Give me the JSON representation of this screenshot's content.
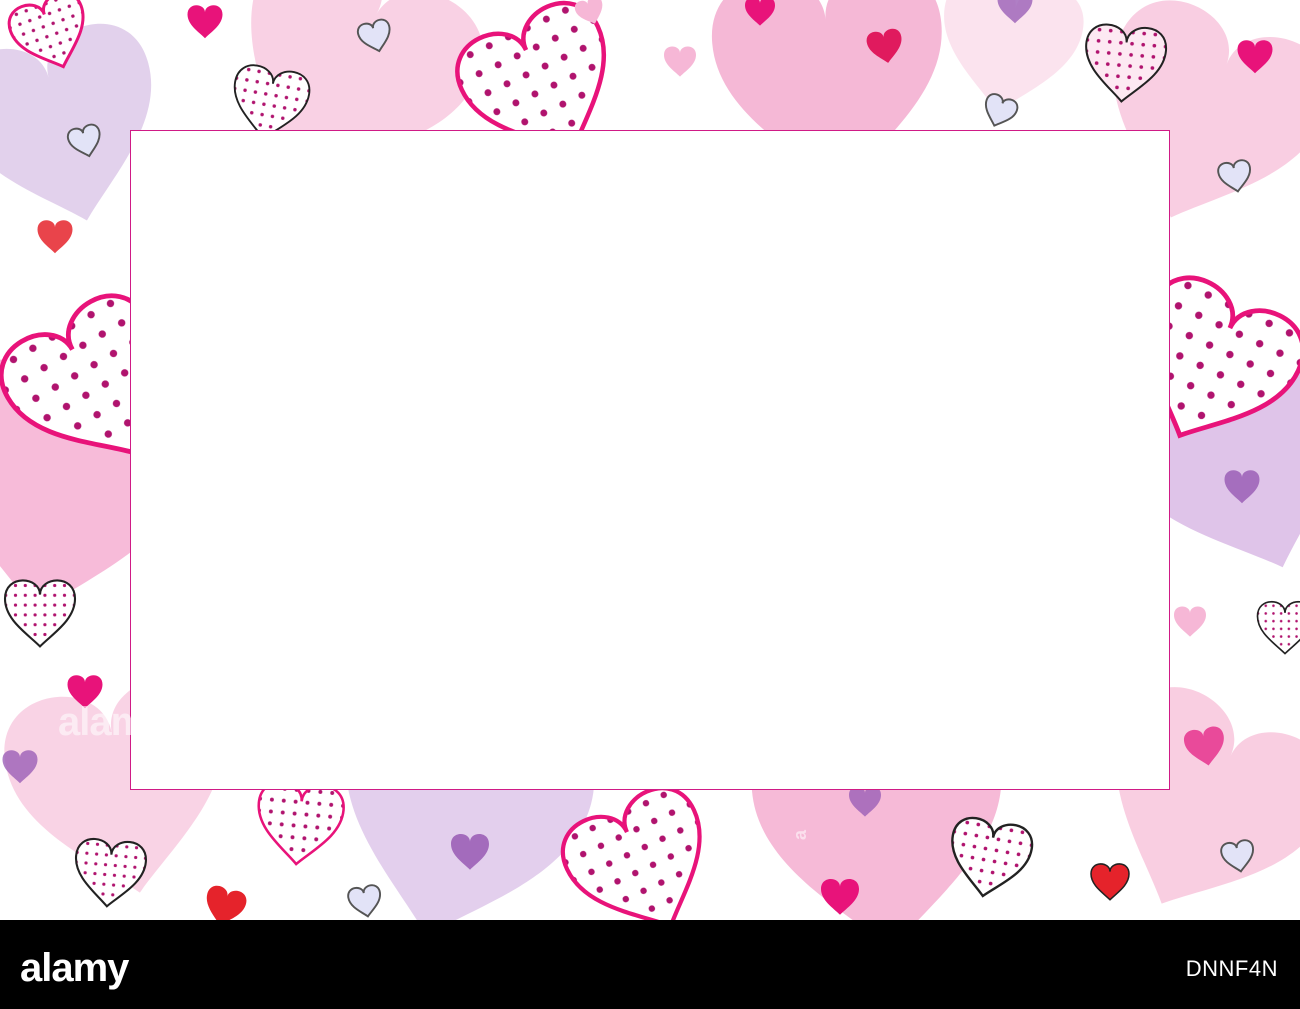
{
  "footer": {
    "brand": "alamy",
    "image_code": "DNNF4N"
  },
  "watermarks": {
    "left": "alamy",
    "right": "a",
    "bottom": "a"
  },
  "colors": {
    "frame_border": "#d01a86",
    "footer_bg": "#000000",
    "hot_pink": "#e8137a",
    "light_pink": "#f6b7d6",
    "lavender": "#c9a8dd",
    "purple": "#9b5fb6",
    "red": "#e5232b"
  },
  "icons": [
    "heart-icon",
    "polka-dot-heart-icon",
    "outline-heart-icon"
  ]
}
